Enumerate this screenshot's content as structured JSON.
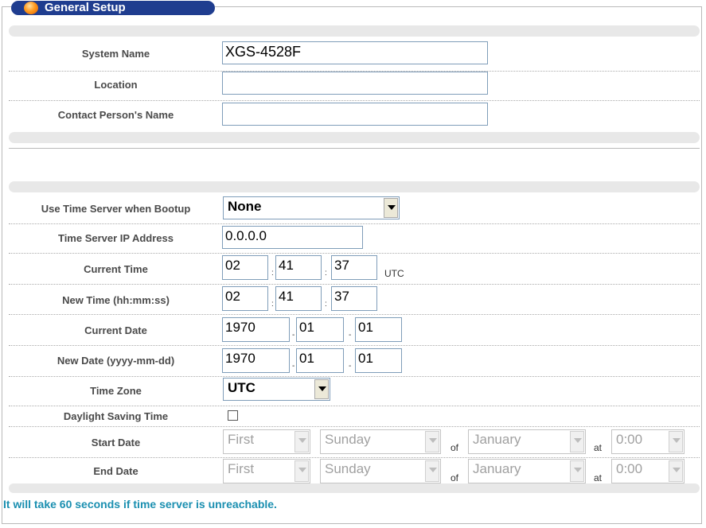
{
  "section": {
    "title": "General Setup"
  },
  "system": {
    "system_name_label": "System Name",
    "system_name_value": "XGS-4528F",
    "location_label": "Location",
    "location_value": "",
    "contact_label": "Contact Person's Name",
    "contact_value": ""
  },
  "time": {
    "use_time_server_label": "Use Time Server when Bootup",
    "use_time_server_value": "None",
    "ip_label": "Time Server IP Address",
    "ip_value": "0.0.0.0",
    "current_time_label": "Current Time",
    "current_time": {
      "hh": "02",
      "mm": "41",
      "ss": "37",
      "unit": "UTC"
    },
    "new_time_label": "New Time (hh:mm:ss)",
    "new_time": {
      "hh": "02",
      "mm": "41",
      "ss": "37"
    },
    "current_date_label": "Current Date",
    "current_date": {
      "yyyy": "1970",
      "mm": "01",
      "dd": "01"
    },
    "new_date_label": "New Date (yyyy-mm-dd)",
    "new_date": {
      "yyyy": "1970",
      "mm": "01",
      "dd": "01"
    },
    "timezone_label": "Time Zone",
    "timezone_value": "UTC",
    "dst_label": "Daylight Saving Time",
    "dst_checked": false,
    "start_label": "Start Date",
    "end_label": "End Date",
    "start": {
      "week": "First",
      "day": "Sunday",
      "of": "of",
      "month": "January",
      "at": "at",
      "time": "0:00"
    },
    "end": {
      "week": "First",
      "day": "Sunday",
      "of": "of",
      "month": "January",
      "at": "at",
      "time": "0:00"
    },
    "colon": ":",
    "dash": "-"
  },
  "note": "It will take 60 seconds if time server is unreachable."
}
